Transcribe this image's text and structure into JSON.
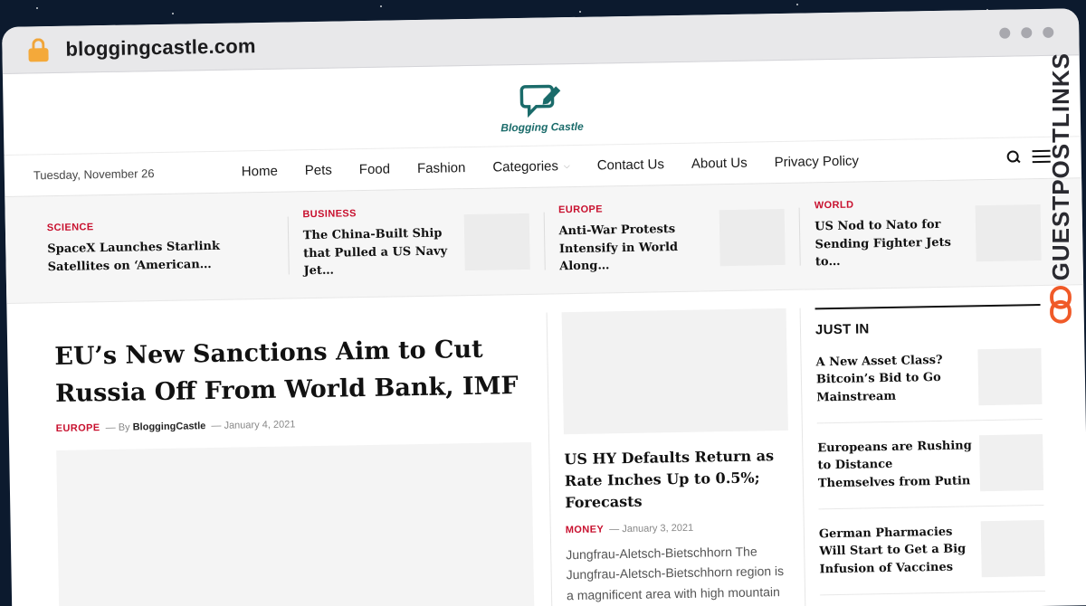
{
  "browser": {
    "url": "bloggingcastle.com"
  },
  "brand_watermark": {
    "text": "GUESTPOSTLINKS",
    "accent": "#f05a28"
  },
  "site": {
    "logo_text": "Blogging Castle",
    "brand_color": "#1a6b6a"
  },
  "nav": {
    "date": "Tuesday, November 26",
    "items": [
      {
        "label": "Home"
      },
      {
        "label": "Pets"
      },
      {
        "label": "Food"
      },
      {
        "label": "Fashion"
      },
      {
        "label": "Categories"
      },
      {
        "label": "Contact Us"
      },
      {
        "label": "About Us"
      },
      {
        "label": "Privacy Policy"
      }
    ]
  },
  "ticker": [
    {
      "category": "SCIENCE",
      "title": "SpaceX Launches Starlink Satellites on ‘American…"
    },
    {
      "category": "BUSINESS",
      "title": "The China-Built Ship that Pulled a US Navy Jet…"
    },
    {
      "category": "EUROPE",
      "title": "Anti-War Protests Intensify in World Along…"
    },
    {
      "category": "WORLD",
      "title": "US Nod to Nato for Sending Fighter Jets to…"
    }
  ],
  "featured": {
    "title": "EU’s New Sanctions Aim to Cut Russia Off From World Bank, IMF",
    "category": "EUROPE",
    "by": "By",
    "author": "BloggingCastle",
    "date": "January 4, 2021"
  },
  "secondary": {
    "title": "US HY Defaults Return as Rate Inches Up to 0.5%; Forecasts",
    "category": "MONEY",
    "date": "January 3, 2021",
    "excerpt": "Jungfrau-Aletsch-Bietschhorn The Jungfrau-Aletsch-Bietschhorn region is a magnificent area with high mountain ranges,…"
  },
  "sidebar": {
    "heading": "JUST IN",
    "items": [
      {
        "title": "A New Asset Class? Bitcoin’s Bid to Go Mainstream"
      },
      {
        "title": "Europeans are Rushing to Distance Themselves from Putin"
      },
      {
        "title": "German Pharmacies Will Start to Get a Big Infusion of Vaccines"
      }
    ]
  }
}
